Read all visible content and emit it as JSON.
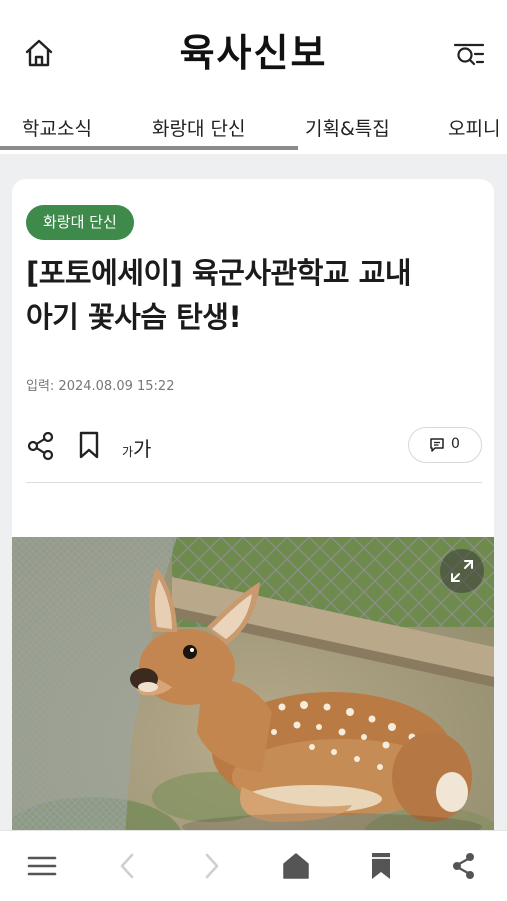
{
  "header": {
    "logo": "육사신보",
    "home_icon": "home-icon",
    "menu_icon": "search-menu-icon"
  },
  "tabs": [
    {
      "label": "학교소식"
    },
    {
      "label": "화랑대 단신"
    },
    {
      "label": "기획&특집"
    },
    {
      "label": "오피니"
    }
  ],
  "article": {
    "category": "화랑대 단신",
    "title_line1": "[포토에세이] 육군사관학교 교내",
    "title_line2": "아기 꽃사슴 탄생!",
    "date": "입력: 2024.08.09 15:22",
    "font_small": "가",
    "font_large": "가",
    "comment_count": "0",
    "photo_icon": "fawn-photo"
  },
  "bottom_bar": {
    "icons": [
      "menu-icon",
      "back-icon",
      "forward-icon",
      "home-icon",
      "bookmark-icon",
      "share-icon"
    ]
  },
  "colors": {
    "badge": "#3d8a4b",
    "background": "#eeeff1",
    "tab_indicator": "#8b8b8b"
  }
}
